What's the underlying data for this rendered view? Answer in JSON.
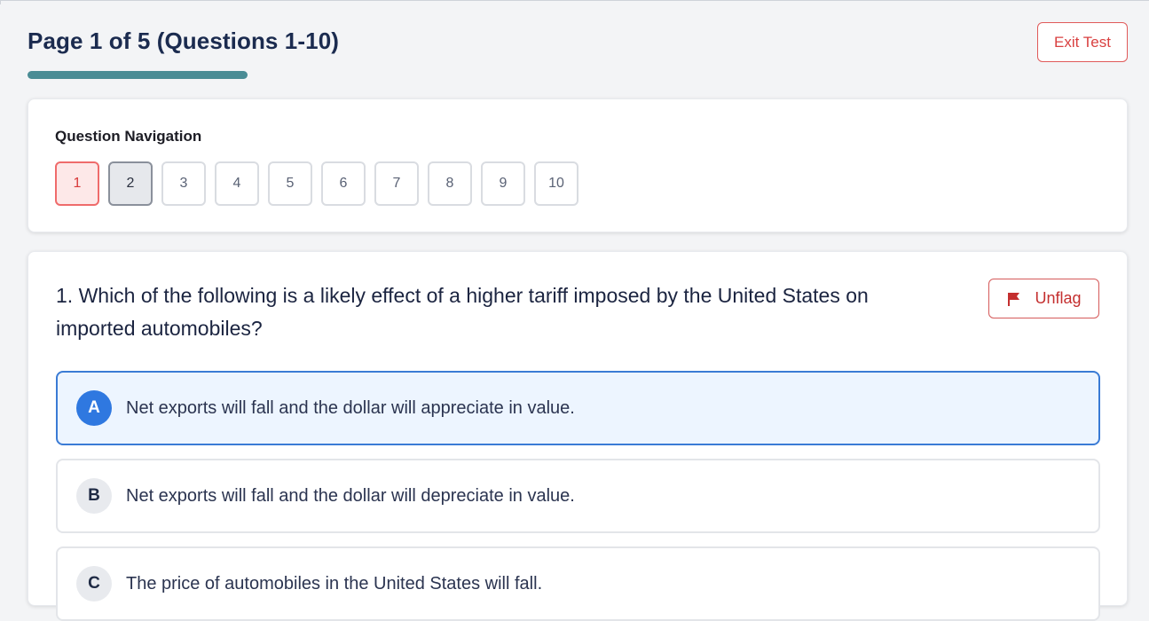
{
  "header": {
    "title": "Page 1 of 5 (Questions 1-10)",
    "progress_fraction": 0.2,
    "exit_label": "Exit Test"
  },
  "navigation": {
    "title": "Question Navigation",
    "questions": [
      "1",
      "2",
      "3",
      "4",
      "5",
      "6",
      "7",
      "8",
      "9",
      "10"
    ],
    "current": "1",
    "visited": [
      "2"
    ]
  },
  "question": {
    "text": "1. Which of the following is a likely effect of a higher tariff imposed by the United States on imported automobiles?",
    "flag_label": "Unflag",
    "options": [
      {
        "letter": "A",
        "text": "Net exports will fall and the dollar will appreciate in value.",
        "selected": true
      },
      {
        "letter": "B",
        "text": "Net exports will fall and the dollar will depreciate in value.",
        "selected": false
      },
      {
        "letter": "C",
        "text": "The price of automobiles in the United States will fall.",
        "selected": false
      }
    ]
  },
  "colors": {
    "accent": "#4a8c95",
    "danger": "#d94040",
    "selected_blue": "#2f78e0"
  }
}
